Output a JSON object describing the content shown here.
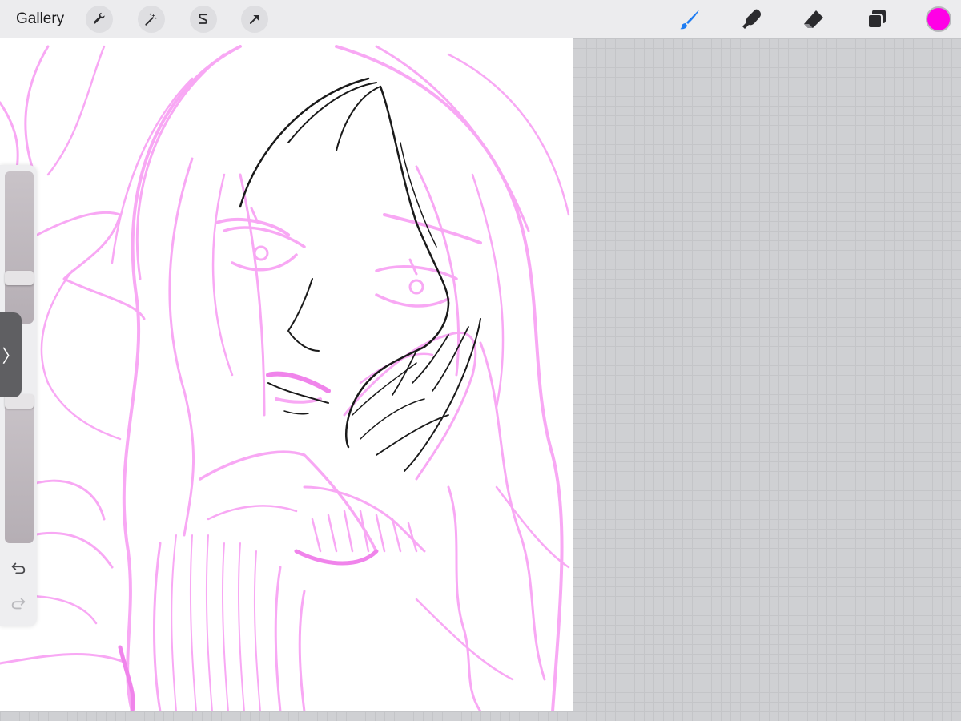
{
  "toolbar": {
    "gallery_label": "Gallery",
    "left_tools": [
      {
        "name": "actions",
        "icon": "wrench-icon"
      },
      {
        "name": "adjustments",
        "icon": "magic-wand-icon"
      },
      {
        "name": "selection",
        "icon": "selection-s-icon"
      },
      {
        "name": "transform",
        "icon": "arrow-cursor-icon"
      }
    ],
    "right_tools": [
      {
        "name": "brush",
        "icon": "brush-icon",
        "active": true
      },
      {
        "name": "smudge",
        "icon": "smudge-finger-icon",
        "active": false
      },
      {
        "name": "eraser",
        "icon": "eraser-icon",
        "active": false
      },
      {
        "name": "layers",
        "icon": "layers-icon",
        "active": false
      }
    ],
    "current_color": "#ff00e6",
    "active_tool_color": "#1e7cf2"
  },
  "sidebar": {
    "modify_icon": "chevron-right-icon",
    "modify_glyph": "〉",
    "undo_icon": "undo-arrow-icon",
    "redo_icon": "redo-arrow-icon"
  },
  "canvas": {
    "sketch_color": "#f58cf0",
    "lineart_color": "#1a1a1a"
  }
}
